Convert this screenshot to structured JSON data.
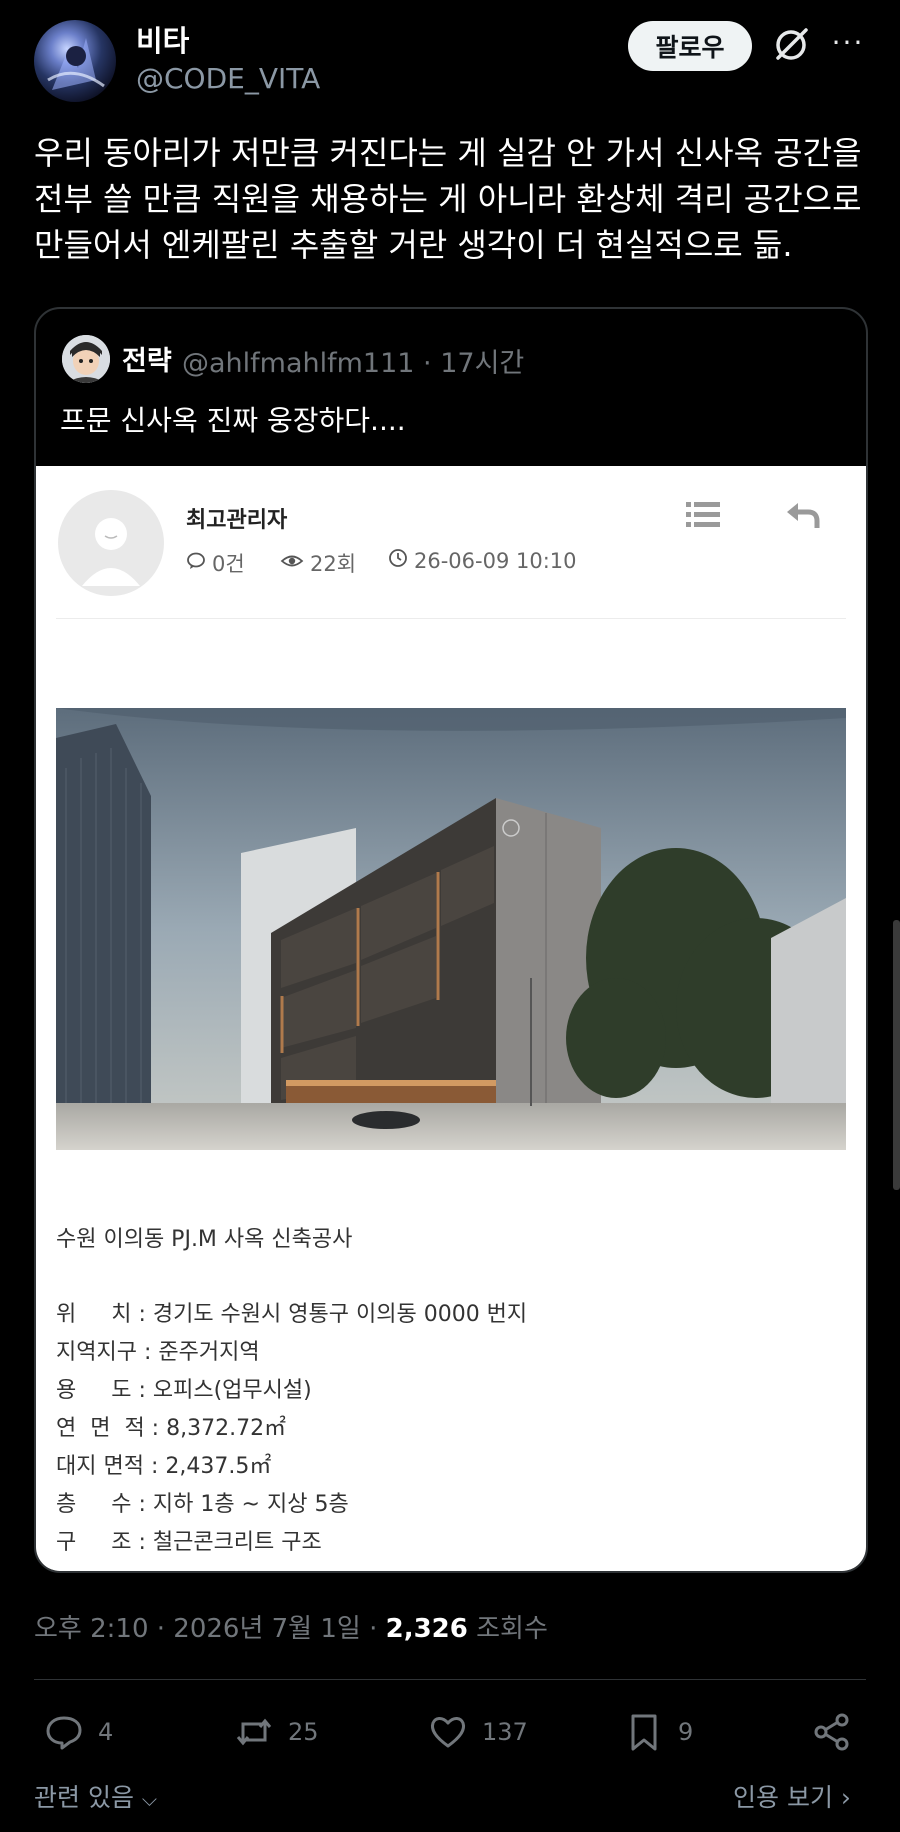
{
  "author": {
    "name": "비타",
    "handle": "@CODE_VITA",
    "avatar_icon": "avatar-anime-blue"
  },
  "header": {
    "follow_label": "팔로우",
    "grok_icon": "grok-icon",
    "more_label": "···"
  },
  "tweet": {
    "text": "우리 동아리가 저만큼 커진다는 게 실감 안 가서 신사옥 공간을 전부 쓸 만큼 직원을 채용하는 게 아니라 환상체 격리 공간으로 만들어서 엔케팔린 추출할 거란 생각이 더 현실적으로 듦."
  },
  "quote": {
    "name": "전략",
    "handle_time": "@ahlfmahlfm111 · 17시간",
    "text": "프문 신사옥 진짜 웅장하다....",
    "card": {
      "author": "최고관리자",
      "comments": "0건",
      "views": "22회",
      "datetime": "26-06-09 10:10",
      "title": "수원 이의동 PJ.M 사옥 신축공사",
      "specs": [
        "위     치 : 경기도 수원시 영통구 이의동 0000 번지",
        "지역지구 : 준주거지역",
        "용     도 : 오피스(업무시설)",
        "연  면  적 : 8,372.72㎡",
        "대지 면적 : 2,437.5㎡",
        "층     수 : 지하 1층 ~ 지상 5층",
        "구     조 : 철근콘크리트 구조"
      ]
    }
  },
  "meta": {
    "time_date": "오후 2:10 · 2026년 7월 1일 · ",
    "views_count": "2,326",
    "views_label": " 조회수"
  },
  "actions": {
    "replies": "4",
    "retweets": "25",
    "likes": "137",
    "bookmarks": "9"
  },
  "footer": {
    "related": "관련 있음",
    "quotes": "인용 보기"
  },
  "colors": {
    "background": "#000000",
    "muted": "#71767b",
    "text": "#e7e9ea",
    "card_bg": "#ffffff"
  }
}
